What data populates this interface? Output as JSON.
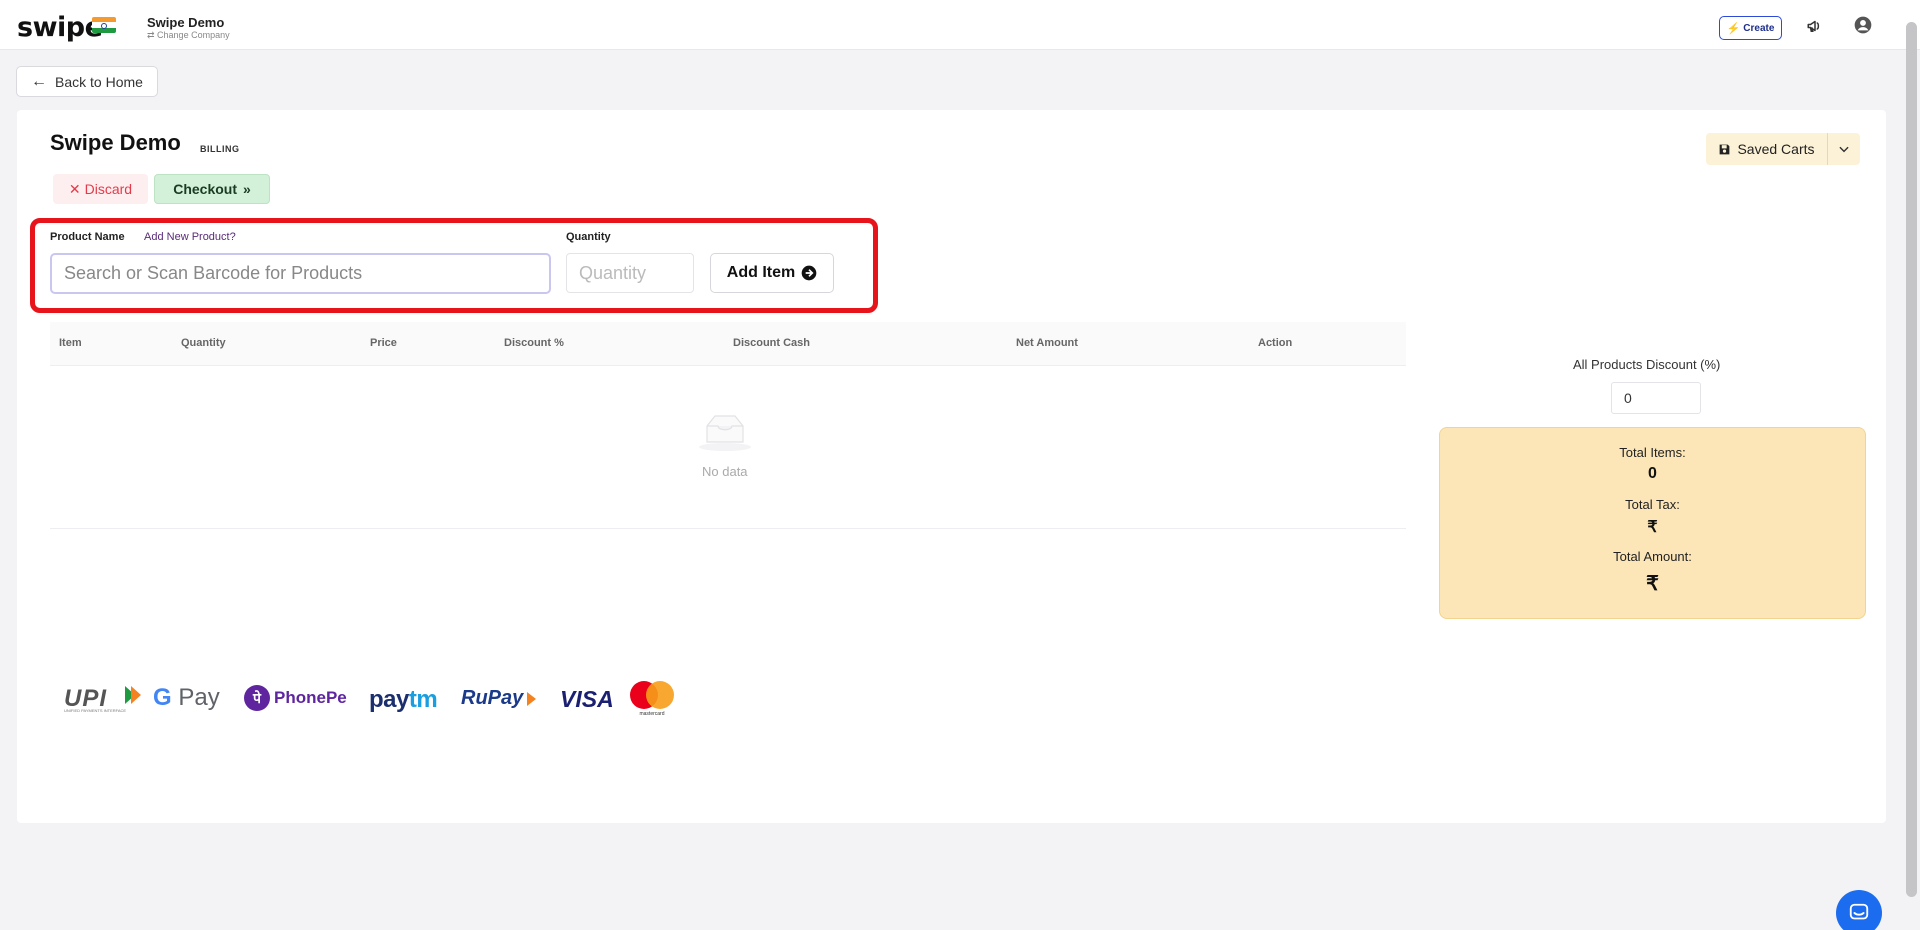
{
  "topbar": {
    "logo": "swipe",
    "company_name": "Swipe Demo",
    "change_company": "⇄ Change Company",
    "create_label": "Create"
  },
  "back_button": {
    "label": "Back to Home"
  },
  "page": {
    "title": "Swipe Demo",
    "tag": "BILLING",
    "discard_label": "Discard",
    "checkout_label": "Checkout",
    "saved_carts_label": "Saved Carts"
  },
  "form": {
    "product_name_label": "Product Name",
    "add_new_product_link": "Add New Product?",
    "quantity_label": "Quantity",
    "search_placeholder": "Search or Scan Barcode for Products",
    "search_value": "",
    "quantity_placeholder": "Quantity",
    "quantity_value": "",
    "add_item_label": "Add Item"
  },
  "table": {
    "columns": [
      "Item",
      "Quantity",
      "Price",
      "Discount %",
      "Discount Cash",
      "Net Amount",
      "Action"
    ],
    "rows": [],
    "empty_text": "No data"
  },
  "summary": {
    "all_products_discount_label": "All Products Discount (%)",
    "all_products_discount_value": "0",
    "total_items_label": "Total Items:",
    "total_items_value": "0",
    "total_tax_label": "Total Tax:",
    "total_tax_value": "₹",
    "total_amount_label": "Total Amount:",
    "total_amount_value": "₹"
  },
  "payments": {
    "upi": "UPI",
    "upi_sub": "UNIFIED PAYMENTS INTERFACE",
    "gpay_g": "G",
    "gpay_rest": " Pay",
    "phonepe_mark": "पे",
    "phonepe": "PhonePe",
    "paytm_a": "pay",
    "paytm_b": "tm",
    "rupay": "RuPay",
    "visa": "VISA",
    "mastercard": "mastercard"
  },
  "colors": {
    "highlight": "#e8141c",
    "discard_text": "#e43b4a",
    "checkout_bg": "#d3f0d9",
    "totals_bg": "#fce6b8",
    "create_border": "#2d4bd8",
    "chat_bg": "#1c6cf0"
  },
  "icons": {
    "create": "lightning-icon",
    "notifications": "megaphone-icon",
    "account": "user-circle-icon",
    "back": "arrow-left-icon",
    "discard": "close-icon",
    "checkout": "double-chevron-right-icon",
    "saved_carts": "floppy-disk-icon",
    "saved_carts_menu": "chevron-down-icon",
    "add_item": "arrow-circle-right-icon",
    "empty": "empty-inbox-icon",
    "chat": "chat-bubble-icon"
  }
}
